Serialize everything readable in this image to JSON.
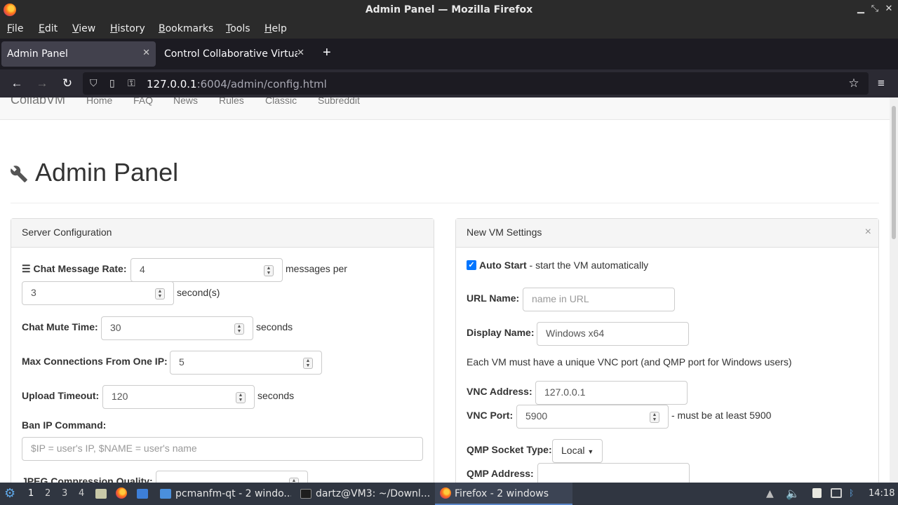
{
  "window": {
    "title": "Admin Panel — Mozilla Firefox"
  },
  "menu": [
    "File",
    "Edit",
    "View",
    "History",
    "Bookmarks",
    "Tools",
    "Help"
  ],
  "tabs": [
    {
      "label": "Admin Panel",
      "active": true
    },
    {
      "label": "Control Collaborative Virtual",
      "active": false
    }
  ],
  "url": {
    "host": "127.0.0.1",
    "rest": ":6004/admin/config.html"
  },
  "site_nav": {
    "brand": "CollabVM",
    "links": [
      "Home",
      "FAQ",
      "News",
      "Rules",
      "Classic",
      "Subreddit"
    ]
  },
  "page": {
    "title": "Admin Panel"
  },
  "server_config": {
    "heading": "Server Configuration",
    "chat_rate_label": "Chat Message Rate:",
    "chat_rate_value": "4",
    "chat_rate_unit": "messages per",
    "chat_rate_seconds": "3",
    "chat_rate_seconds_unit": "second(s)",
    "mute_label": "Chat Mute Time:",
    "mute_value": "30",
    "mute_unit": "seconds",
    "maxconn_label": "Max Connections From One IP:",
    "maxconn_value": "5",
    "upload_label": "Upload Timeout:",
    "upload_value": "120",
    "upload_unit": "seconds",
    "ban_label": "Ban IP Command:",
    "ban_placeholder": "$IP = user's IP, $NAME = user's name",
    "jpeg_label": "JPEG Compression Quality:"
  },
  "vm_settings": {
    "heading": "New VM Settings",
    "autostart_label": "Auto Start",
    "autostart_desc": " - start the VM automatically",
    "autostart_checked": true,
    "url_name_label": "URL Name:",
    "url_name_placeholder": "name in URL",
    "display_name_label": "Display Name:",
    "display_name_value": "Windows x64",
    "vnc_note": "Each VM must have a unique VNC port (and QMP port for Windows users)",
    "vnc_address_label": "VNC Address:",
    "vnc_address_value": "127.0.0.1",
    "vnc_port_label": "VNC Port:",
    "vnc_port_value": "5900",
    "vnc_port_note": "- must be at least 5900",
    "qmp_type_label": "QMP Socket Type:",
    "qmp_type_value": "Local",
    "qmp_address_label": "QMP Address:",
    "qmp_address_value": ""
  },
  "taskbar": {
    "workspaces": [
      "1",
      "2",
      "3",
      "4"
    ],
    "tasks": [
      "pcmanfm-qt - 2 windo...",
      "dartz@VM3: ~/Downl...",
      "Firefox - 2 windows"
    ],
    "clock": "14:18"
  }
}
